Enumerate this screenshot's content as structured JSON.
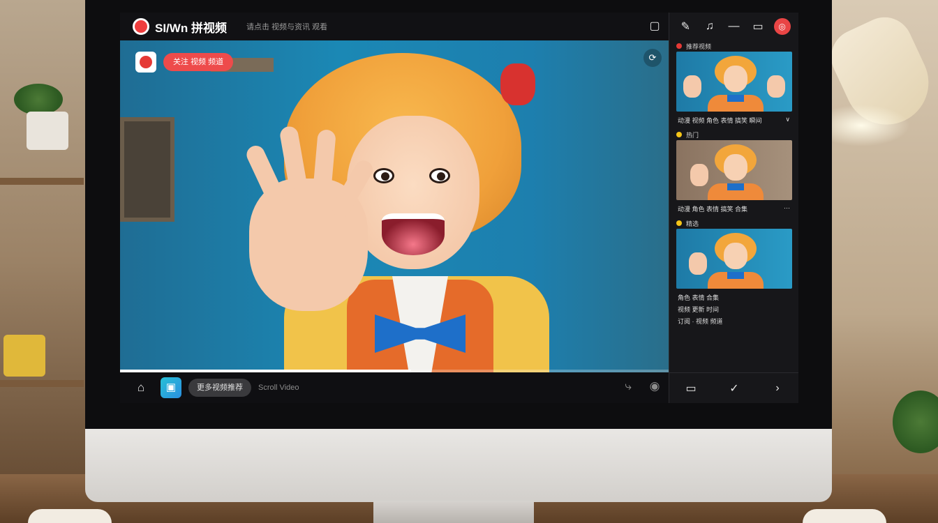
{
  "app": {
    "brand": "SI/Wn 拼视频",
    "subtitle": "请点击 视频与资讯 观看"
  },
  "window_controls": {
    "edit_icon": "pencil-icon",
    "notifications_icon": "bell-icon",
    "minimize_icon": "minimize-icon",
    "maximize_icon": "window-icon",
    "avatar_icon": "user-avatar-icon"
  },
  "video": {
    "channel_logo": "channel-logo-icon",
    "subscribe_label": "关注 视频 频道",
    "corner_button_icon": "refresh-icon",
    "progress": 0.53
  },
  "controls": {
    "home_icon": "home-icon",
    "app_icon": "gallery-icon",
    "chip_label": "更多视频推荐",
    "text_label": "Scroll Video",
    "share_icon": "share-icon",
    "play_icon": "play-circle-icon"
  },
  "sidebar": {
    "items": [
      {
        "tag": "推荐视频",
        "tag_color": "#e53935",
        "title": "动漫 视频 角色 表情 搞笑 瞬间",
        "menu": "∨"
      },
      {
        "tag": "热门",
        "tag_color": "#f5c518",
        "title": "动漫 角色 表情 搞笑 合集",
        "menu": "⋯"
      },
      {
        "tag": "精选",
        "tag_color": "#f5c518",
        "title": "角色 表情 合集",
        "meta1": "视频 更新 时间",
        "meta2": "订阅 · 视频 频道"
      }
    ],
    "bottom": {
      "comment_icon": "comment-icon",
      "like_icon": "thumbs-up-icon",
      "forward_icon": "forward-icon"
    }
  },
  "colors": {
    "accent": "#ef3d3d",
    "background": "#111114",
    "sidebar_bg": "#17171a"
  }
}
